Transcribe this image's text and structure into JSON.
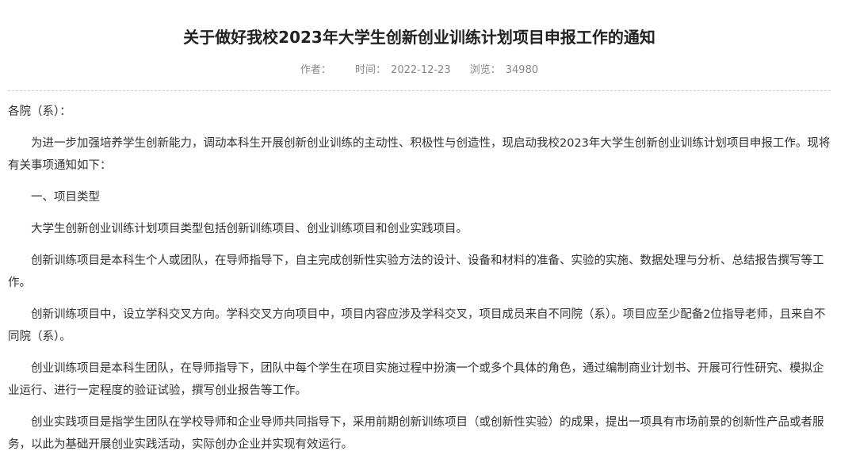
{
  "article": {
    "title": "关于做好我校2023年大学生创新创业训练计划项目申报工作的通知",
    "meta": {
      "author_label": "作者：",
      "author_value": "",
      "time_label": "时间：",
      "time_value": "2022-12-23",
      "views_label": "浏览：",
      "views_value": "34980"
    },
    "paragraphs": [
      "各院（系）：",
      "为进一步加强培养学生创新能力，调动本科生开展创新创业训练的主动性、积极性与创造性，现启动我校2023年大学生创新创业训练计划项目申报工作。现将有关事项通知如下：",
      "一、项目类型",
      "大学生创新创业训练计划项目类型包括创新训练项目、创业训练项目和创业实践项目。",
      "创新训练项目是本科生个人或团队，在导师指导下，自主完成创新性实验方法的设计、设备和材料的准备、实验的实施、数据处理与分析、总结报告撰写等工作。",
      "创新训练项目中，设立学科交叉方向。学科交叉方向项目中，项目内容应涉及学科交叉，项目成员来自不同院（系）。项目应至少配备2位指导老师，且来自不同院（系）。",
      "创业训练项目是本科生团队，在导师指导下，团队中每个学生在项目实施过程中扮演一个或多个具体的角色，通过编制商业计划书、开展可行性研究、模拟企业运行、进行一定程度的验证试验，撰写创业报告等工作。",
      "创业实践项目是指学生团队在学校导师和企业导师共同指导下，采用前期创新训练项目（或创新性实验）的成果，提出一项具有市场前景的创新性产品或者服务，以此为基础开展创业实践活动，实际创办企业并实现有效运行。"
    ]
  }
}
